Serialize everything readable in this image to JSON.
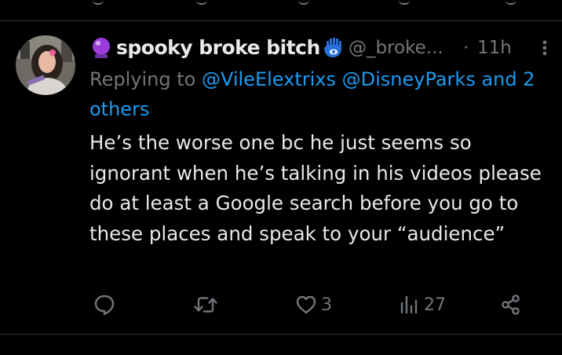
{
  "tweet": {
    "author_name": "spooky broke bitch",
    "handle": "@_broke...",
    "separator": "·",
    "time": "11h",
    "reply_prefix": "Replying to",
    "reply_mentions": [
      "@VileElextrixs",
      "@DisneyParks"
    ],
    "reply_and": "and",
    "reply_others": "2 others",
    "body": "He’s the worse one bc he just seems so ignorant when he’s talking in his videos please do at least a Google search before you go to these places and speak to your “audience”"
  },
  "actions": {
    "reply_count": "",
    "retweet_count": "",
    "like_count": "3",
    "views_count": "27"
  },
  "icons": {
    "name_prefix": "crystal-ball-icon",
    "name_suffix": "hamsa-hand-icon",
    "more": "more-dots-icon",
    "reply": "reply-icon",
    "retweet": "retweet-icon",
    "like": "heart-icon",
    "views": "views-bars-icon",
    "share": "share-icon"
  },
  "colors": {
    "background": "#000000",
    "text": "#e7e9ea",
    "muted": "#71767b",
    "link": "#1d9bf0",
    "divider": "#2f3336",
    "emoji_purple": "#9b3ddb",
    "emoji_blue": "#2a6fd6"
  }
}
